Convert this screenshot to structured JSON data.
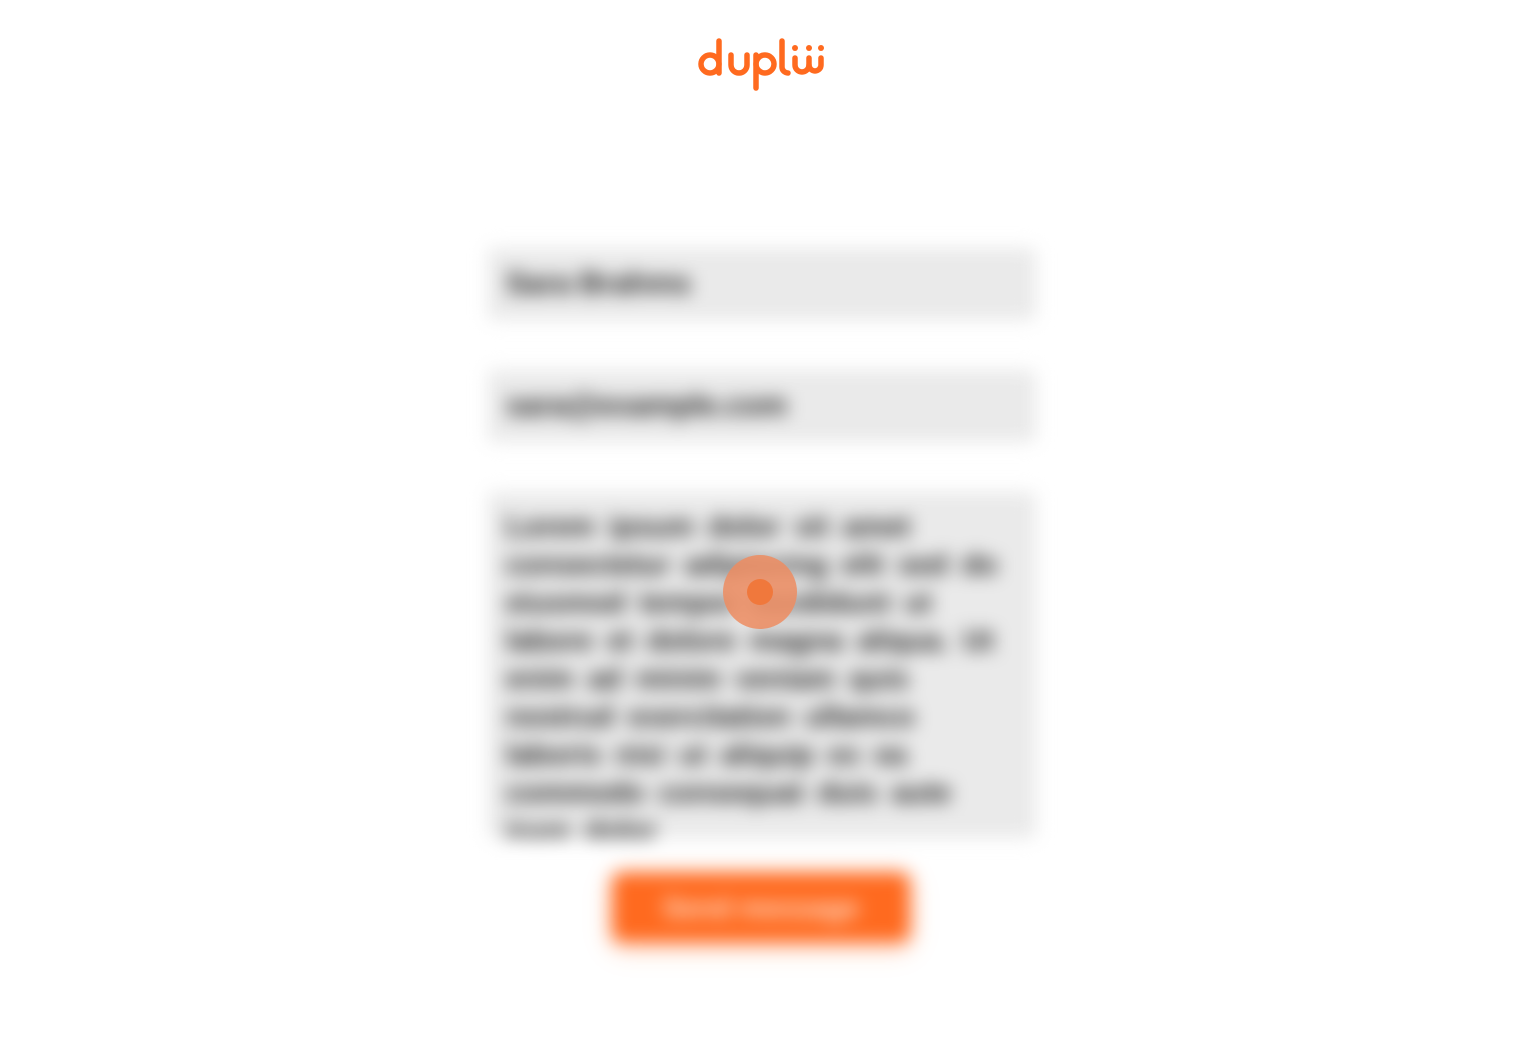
{
  "brand": {
    "name": "duplii",
    "accent_color": "#ff6a1f"
  },
  "form": {
    "name_value": "Sara Brahms",
    "email_value": "sara@example.com",
    "message_value": "Lorem ipsum dolor sit amet consectetur adipiscing elit sed do eiusmod tempor incididunt ut labore et dolore magna aliqua. Ut enim ad minim veniam quis nostrud exercitation ullamco laboris nisi ut aliquip ex ea commodo consequat duis aute irure dolor",
    "submit_label": "Send message"
  },
  "status": {
    "loading_icon": "loading-spinner-icon"
  }
}
